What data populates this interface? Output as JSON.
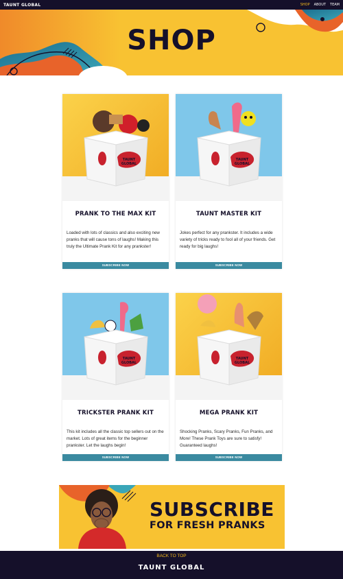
{
  "nav": {
    "brand": "TAUNT GLOBAL",
    "links": [
      "SHOP",
      "ABOUT",
      "TEAM"
    ]
  },
  "hero": {
    "title": "SHOP"
  },
  "products": [
    {
      "title": "PRANK TO THE MAX KIT",
      "description": "Loaded with lots of classics and also exciting new pranks that will cause tons of laughs! Making this truly the Ultimate Prank Kit for any prankster!",
      "button": "SUBSCRIBE NOW",
      "box_label": "TAUNT GLOBAL"
    },
    {
      "title": "TAUNT MASTER KIT",
      "description": "Jokes perfect for any prankster. It includes a wide variety of tricks ready to fool all of your friends. Get ready for big laughs!",
      "button": "SUBSCRIBE NOW",
      "box_label": "TAUNT GLOBAL"
    },
    {
      "title": "TRICKSTER PRANK KIT",
      "description": "This kit includes all the classic top sellers out on the market. Lots of great items for the beginner prankster. Let the laughs begin!",
      "button": "SUBSCRIBE NOW",
      "box_label": "TAUNT GLOBAL"
    },
    {
      "title": "MEGA PRANK KIT",
      "description": "Shocking Pranks, Scary Pranks, Fun Pranks, and More! These Prank Toys are sure to satisfy! Guaranteed laughs!",
      "button": "SUBSCRIBE NOW",
      "box_label": "TAUNT GLOBAL"
    }
  ],
  "banner": {
    "headline": "SUBSCRIBE",
    "subline": "FOR FRESH PRANKS"
  },
  "footer": {
    "back_to_top": "BACK TO TOP",
    "brand": "TAUNT GLOBAL"
  },
  "colors": {
    "navy": "#15102a",
    "yellow": "#f8c232",
    "teal": "#3a8aa0",
    "accent_red": "#c8222e",
    "sky_blue": "#7fc7ea"
  }
}
